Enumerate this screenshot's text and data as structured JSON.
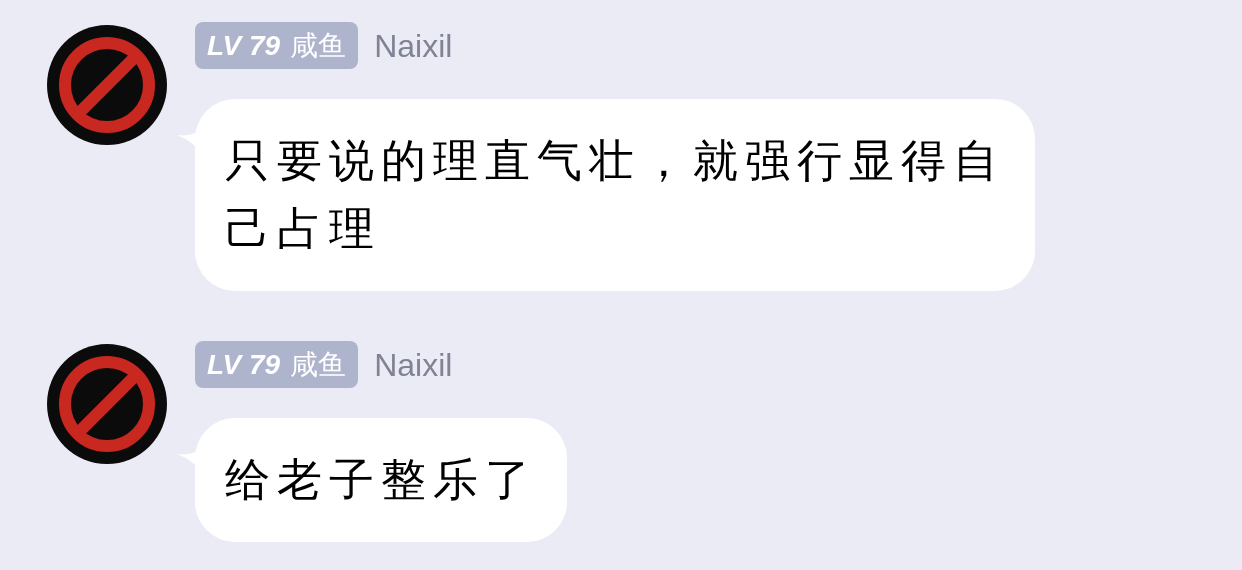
{
  "messages": [
    {
      "level": "LV 79",
      "title": "咸鱼",
      "name": "Naixil",
      "text": "只要说的理直气壮，就强行显得自己占理"
    },
    {
      "level": "LV 79",
      "title": "咸鱼",
      "name": "Naixil",
      "text": "给老子整乐了"
    }
  ]
}
